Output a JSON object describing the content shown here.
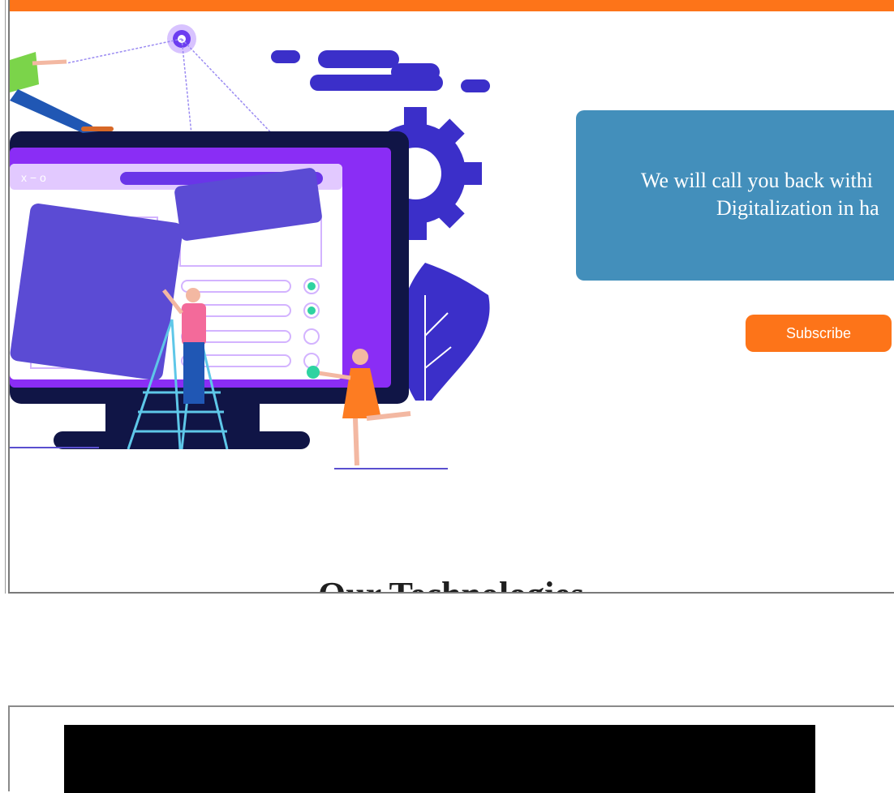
{
  "colors": {
    "accent": "#fd7419",
    "card": "#438fbb",
    "illustration_purple": "#5b4bd4",
    "illustration_violet": "#8a2df5",
    "illustration_navy": "#101546"
  },
  "hero": {
    "illustration_icon": "website-building-illustration",
    "callback_line1": "We will call you back withi",
    "callback_line2": "Digitalization in ha",
    "subscribe_label": "Subscribe"
  },
  "technologies": {
    "heading": "Our Technologies"
  }
}
